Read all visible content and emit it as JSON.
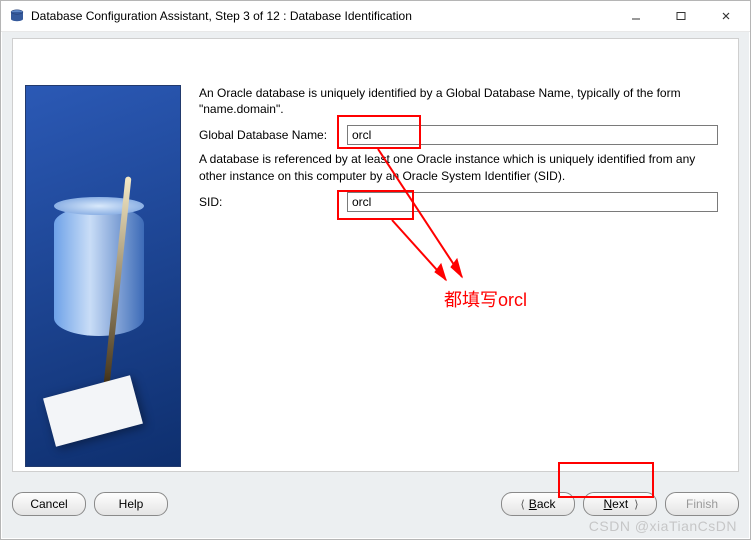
{
  "titlebar": {
    "title": "Database Configuration Assistant, Step 3 of 12 : Database Identification",
    "minimize_tip": "Minimize",
    "maximize_tip": "Maximize",
    "close_tip": "Close"
  },
  "wizard": {
    "intro_text": "An Oracle database is uniquely identified by a Global Database Name, typically of the form \"name.domain\".",
    "global_db_label": "Global Database Name:",
    "global_db_value": "orcl",
    "sid_intro_text": "A database is referenced by at least one Oracle instance which is uniquely identified from any other instance on this computer by an Oracle System Identifier (SID).",
    "sid_label": "SID:",
    "sid_value": "orcl"
  },
  "buttons": {
    "cancel": "Cancel",
    "help": "Help",
    "back_symbol": "⟨",
    "back_underline": "B",
    "back_rest": "ack",
    "next_underline": "N",
    "next_rest": "ext",
    "next_symbol": "⟩",
    "finish": "Finish"
  },
  "annotations": {
    "note": "都填写orcl",
    "watermark": "CSDN @xiaTianCsDN"
  }
}
